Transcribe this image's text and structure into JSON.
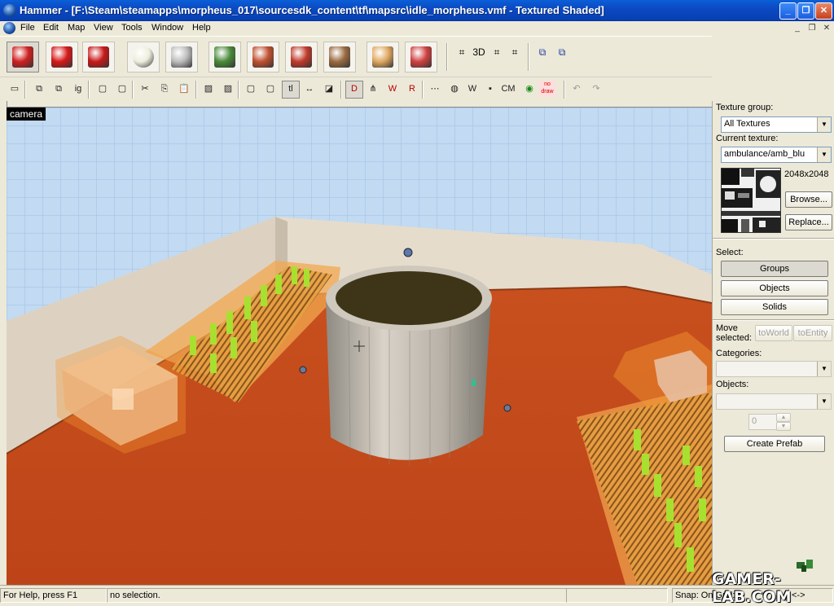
{
  "window": {
    "title": "Hammer - [F:\\Steam\\steamapps\\morpheus_017\\sourcesdk_content\\tf\\mapsrc\\idle_morpheus.vmf - Textured Shaded]",
    "min_glyph": "_",
    "max_glyph": "❐",
    "close_glyph": "✕"
  },
  "menu": {
    "items": [
      "File",
      "Edit",
      "Map",
      "View",
      "Tools",
      "Window",
      "Help"
    ],
    "mdi_min": "_",
    "mdi_restore": "❐",
    "mdi_close": "✕"
  },
  "toolbar1": {
    "tools": [
      {
        "icon": "selection-arrow-icon",
        "color": "#d02020",
        "pressed": true
      },
      {
        "icon": "magnify-icon",
        "color": "#d81818"
      },
      {
        "icon": "camera-icon",
        "color": "#c81818"
      },
      {
        "icon": "entity-lightbulb-icon",
        "color": "#eeeedd"
      },
      {
        "icon": "block-tool-icon",
        "color": "#bdbdbd"
      },
      {
        "icon": "texture-application-icon",
        "color": "#4a8a3a"
      },
      {
        "icon": "apply-decal-icon",
        "color": "#c05030"
      },
      {
        "icon": "overlay-icon",
        "color": "#c03a2a"
      },
      {
        "icon": "clipping-icon",
        "color": "#9a6a40"
      },
      {
        "icon": "vertex-manipulation-icon",
        "color": "#e0a860"
      },
      {
        "icon": "path-tool-icon",
        "color": "#d04040"
      }
    ],
    "grid_buttons": [
      "⌗",
      "3D",
      "⌗",
      "⌗"
    ],
    "carve_buttons": [
      "⧉",
      "⧉"
    ]
  },
  "toolbar2": {
    "buttons": [
      "▭",
      "⧉",
      "⧉",
      "ig",
      "▢",
      "▢",
      "✂",
      "⎘",
      "📋",
      "▨",
      "▨",
      "▢",
      "▢",
      "tl",
      "↔",
      "◪",
      "D",
      "⋔",
      "W",
      "R",
      "⋯",
      "◍",
      "W",
      "▪",
      "CM",
      "◉",
      "no draw",
      "↶",
      "↷"
    ]
  },
  "viewport": {
    "label": "camera"
  },
  "panel": {
    "texture_group_label": "Texture group:",
    "texture_group_value": "All Textures",
    "current_texture_label": "Current texture:",
    "current_texture_value": "ambulance/amb_blu",
    "texture_size": "2048x2048",
    "browse_label": "Browse...",
    "replace_label": "Replace...",
    "select_label": "Select:",
    "groups_label": "Groups",
    "objects_label": "Objects",
    "solids_label": "Solids",
    "move_selected_label_1": "Move",
    "move_selected_label_2": "selected:",
    "to_world_label": "toWorld",
    "to_entity_label": "toEntity",
    "categories_label": "Categories:",
    "objects_list_label": "Objects:",
    "prefab_count": "0",
    "create_prefab_label": "Create Prefab"
  },
  "status": {
    "help": "For Help, press F1",
    "selection": "no selection.",
    "snap": "Snap: On Grid: 8",
    "extra": "<->"
  },
  "watermark": {
    "text": "GAMER-LAB.COM"
  },
  "colors": {
    "floor": "#c84a1e",
    "sky": "#bcd6ef",
    "trigger": "#f2a040",
    "props": "#a8e030",
    "barrel_wood": "#b8b0a4"
  }
}
